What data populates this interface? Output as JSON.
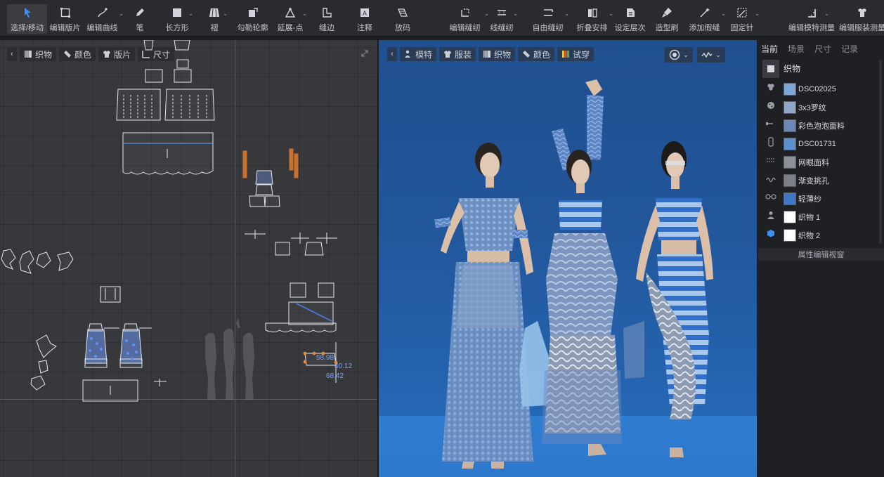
{
  "toolbar": {
    "tools": [
      {
        "label": "选择/移动",
        "icon": "select-arrow-icon",
        "active": true
      },
      {
        "label": "编辑版片",
        "icon": "edit-pattern-icon"
      },
      {
        "label": "编辑曲线",
        "icon": "edit-curve-icon"
      },
      {
        "label": "笔",
        "icon": "pen-icon"
      },
      {
        "label": "长方形",
        "icon": "rectangle-icon"
      },
      {
        "label": "褶",
        "icon": "pleat-icon"
      },
      {
        "label": "勾勒轮廓",
        "icon": "trace-icon"
      },
      {
        "label": "延展-点",
        "icon": "extend-point-icon"
      },
      {
        "label": "缝边",
        "icon": "seam-allowance-icon"
      },
      {
        "label": "注释",
        "icon": "annotation-icon"
      },
      {
        "label": "放码",
        "icon": "grading-icon"
      },
      {
        "label": "编辑缝纫",
        "icon": "edit-sewing-icon"
      },
      {
        "label": "线缝纫",
        "icon": "segment-sewing-icon"
      },
      {
        "label": "自由缝纫",
        "icon": "free-sewing-icon"
      },
      {
        "label": "折叠安排",
        "icon": "fold-arrangement-icon"
      },
      {
        "label": "设定层次",
        "icon": "set-layer-icon"
      },
      {
        "label": "造型刷",
        "icon": "shape-brush-icon"
      },
      {
        "label": "添加假缝",
        "icon": "tack-icon"
      },
      {
        "label": "固定针",
        "icon": "pin-icon"
      },
      {
        "label": "编辑模特测量",
        "icon": "avatar-measure-icon"
      },
      {
        "label": "编辑服装测量",
        "icon": "garment-measure-icon"
      }
    ]
  },
  "panel2d": {
    "tabs": [
      {
        "label": "织物",
        "icon": "fabric-icon"
      },
      {
        "label": "颜色",
        "icon": "color-icon"
      },
      {
        "label": "版片",
        "icon": "pattern-icon"
      },
      {
        "label": "尺寸",
        "icon": "size-icon"
      }
    ],
    "measurements": [
      "58.98",
      "40.12",
      "68.42"
    ]
  },
  "panel3d": {
    "tabs": [
      {
        "label": "模特",
        "icon": "avatar-icon"
      },
      {
        "label": "服装",
        "icon": "garment-icon"
      },
      {
        "label": "织物",
        "icon": "fabric-icon"
      },
      {
        "label": "颜色",
        "icon": "color-icon"
      },
      {
        "label": "试穿",
        "icon": "fitting-icon"
      }
    ]
  },
  "rightpanel": {
    "tabs": [
      "当前",
      "场景",
      "尺寸",
      "记录"
    ],
    "header": "织物",
    "fabrics": [
      {
        "name": "DSC02025",
        "color": "#7fa7d6"
      },
      {
        "name": "3x3罗纹",
        "color": "#8fa8c8"
      },
      {
        "name": "彩色泡泡面料",
        "color": "#6e86b8"
      },
      {
        "name": "DSC01731",
        "color": "#5c8fd0"
      },
      {
        "name": "网眼面料",
        "color": "#8a8f98"
      },
      {
        "name": "渐变挑孔",
        "color": "#7b8088"
      },
      {
        "name": "轻薄纱",
        "color": "#3f78c8"
      },
      {
        "name": "织物 1",
        "color": "#ffffff"
      },
      {
        "name": "织物 2",
        "color": "#ffffff"
      }
    ],
    "property_header": "属性编辑视窗"
  }
}
